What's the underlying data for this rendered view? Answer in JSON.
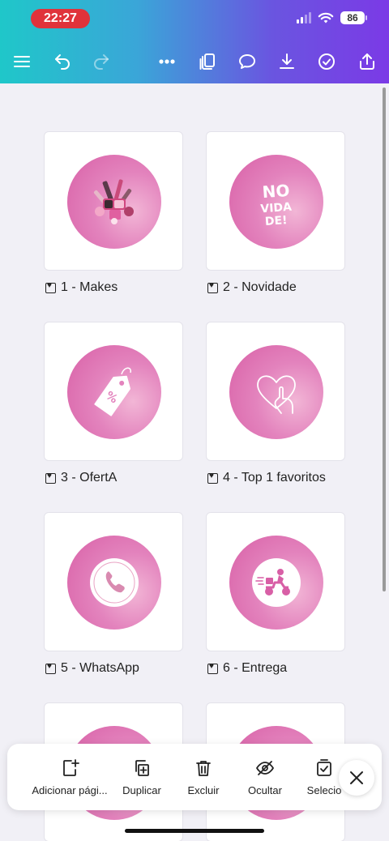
{
  "status": {
    "time": "22:27",
    "battery": "86"
  },
  "colors": {
    "accent_start": "#1fc7c9",
    "accent_end": "#7b3ae6",
    "circle_pink": "#e383bd",
    "time_pill": "#e0333b"
  },
  "toolbar": {
    "icons": [
      "menu-icon",
      "undo-icon",
      "redo-icon",
      "more-icon",
      "pages-icon",
      "comment-icon",
      "download-icon",
      "check-icon",
      "share-icon"
    ]
  },
  "pages": [
    {
      "label": "1 - Makes",
      "icon": "makeup-collage"
    },
    {
      "label": "2 - Novidade",
      "icon": "novidade-lettering",
      "art_text": "NO VIDA DE!"
    },
    {
      "label": "3 - OfertA",
      "icon": "price-tag-icon",
      "art_text": "%"
    },
    {
      "label": "4 - Top 1 favoritos",
      "icon": "heart-hand-icon"
    },
    {
      "label": "5 - WhatsApp",
      "icon": "phone-icon"
    },
    {
      "label": "6 - Entrega",
      "icon": "delivery-scooter-icon"
    },
    {
      "label": "",
      "icon": ""
    },
    {
      "label": "",
      "icon": ""
    }
  ],
  "actions": {
    "add_page": "Adicionar pági...",
    "duplicate": "Duplicar",
    "delete": "Excluir",
    "hide": "Ocultar",
    "select": "Selecio"
  }
}
